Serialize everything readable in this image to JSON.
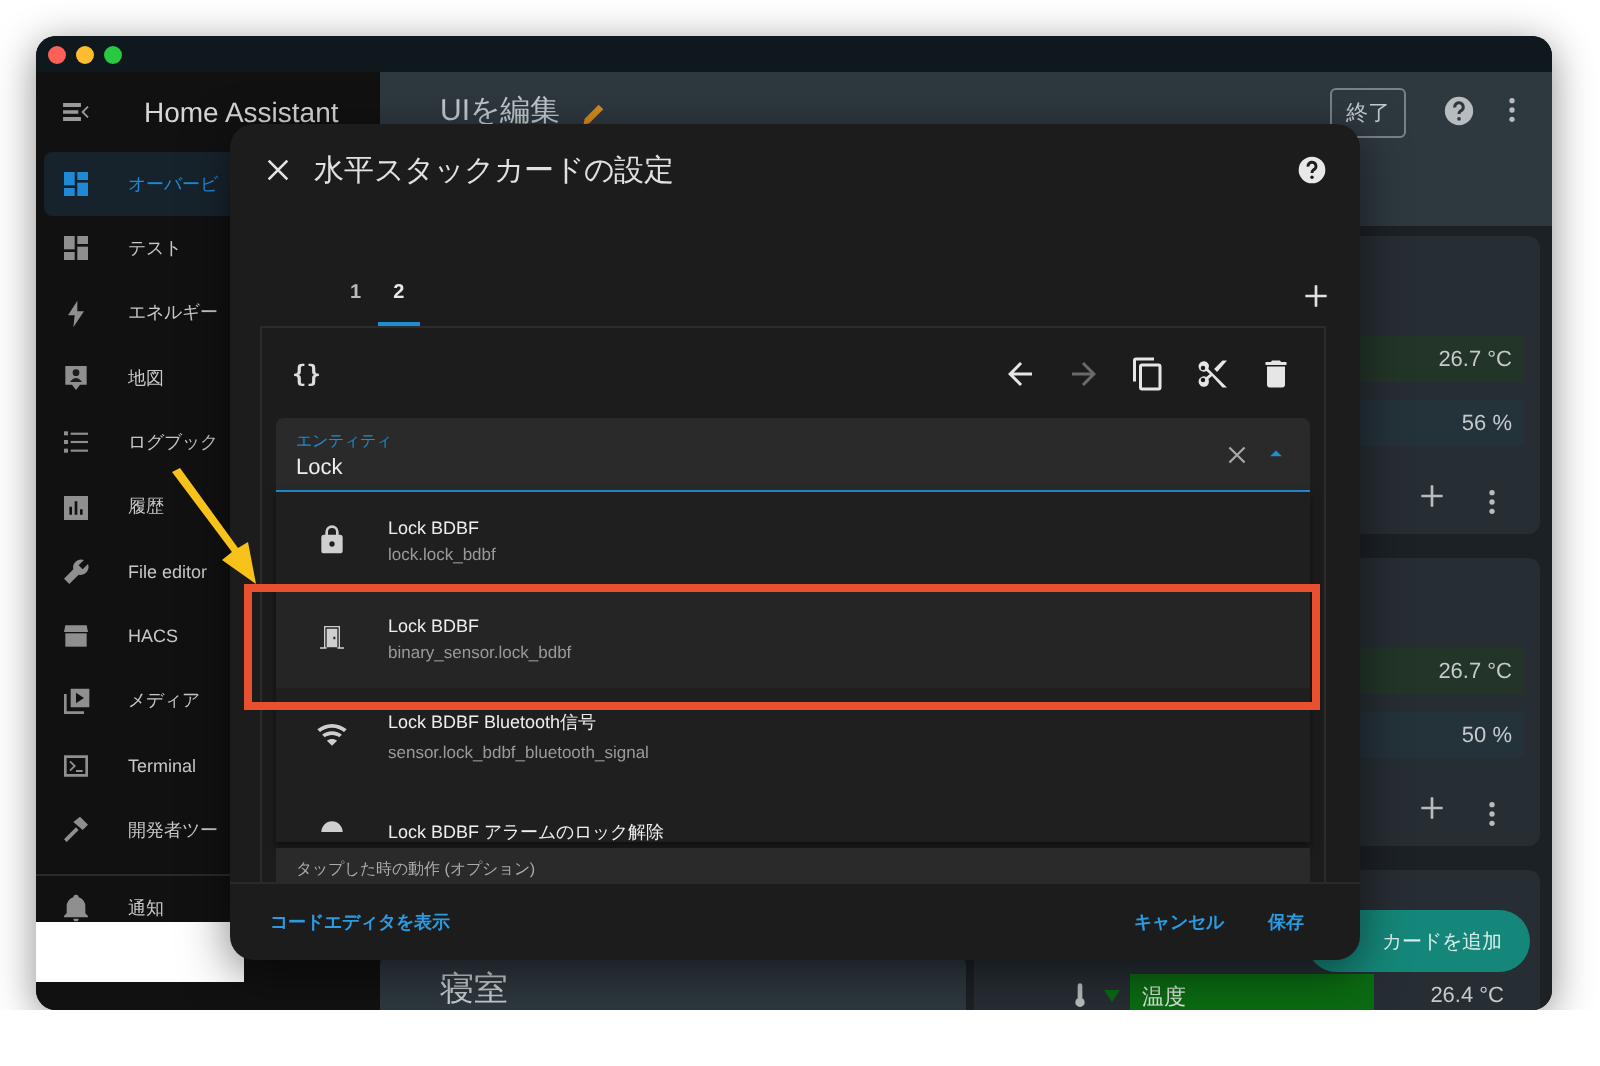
{
  "sidebar": {
    "title": "Home Assistant",
    "items": [
      {
        "label": "オーバービ",
        "kind": "dashboard",
        "selected": true
      },
      {
        "label": "テスト",
        "kind": "dashboard",
        "selected": false
      },
      {
        "label": "エネルギー",
        "kind": "bolt",
        "selected": false
      },
      {
        "label": "地図",
        "kind": "map",
        "selected": false
      },
      {
        "label": "ログブック",
        "kind": "list",
        "selected": false
      },
      {
        "label": "履歴",
        "kind": "chart",
        "selected": false
      },
      {
        "label": "File editor",
        "kind": "wrench",
        "selected": false
      },
      {
        "label": "HACS",
        "kind": "store",
        "selected": false
      },
      {
        "label": "メディア",
        "kind": "media",
        "selected": false
      },
      {
        "label": "Terminal",
        "kind": "terminal",
        "selected": false
      },
      {
        "label": "開発者ツー",
        "kind": "hammer",
        "selected": false
      }
    ],
    "footer_items": [
      {
        "label": "通知",
        "kind": "bell"
      }
    ]
  },
  "header": {
    "title": "UIを編集",
    "done_button": "終了"
  },
  "dashboard": {
    "right_cards": [
      {
        "rows": [
          {
            "value": "26.7 °C",
            "kind": "temperature"
          },
          {
            "value": "56 %",
            "kind": "humidity"
          }
        ]
      },
      {
        "rows": [
          {
            "value": "26.7 °C",
            "kind": "temperature"
          },
          {
            "value": "50 %",
            "kind": "humidity"
          }
        ]
      }
    ],
    "room_card": {
      "title": "寝室"
    },
    "temperature_row": {
      "label": "温度",
      "value": "26.4 °C"
    },
    "add_card_button": "カードを追加"
  },
  "dialog": {
    "title": "水平スタックカードの設定",
    "tabs": [
      {
        "label": "1",
        "selected": false
      },
      {
        "label": "2",
        "selected": true
      }
    ],
    "code_symbol": "{}",
    "toolbar_buttons": [
      {
        "kind": "undo",
        "disabled": false
      },
      {
        "kind": "redo",
        "disabled": true
      },
      {
        "kind": "copy",
        "disabled": false
      },
      {
        "kind": "cut",
        "disabled": false
      },
      {
        "kind": "delete",
        "disabled": false
      }
    ],
    "entity_field": {
      "label": "エンティティ",
      "value": "Lock"
    },
    "suggestions": [
      {
        "name": "Lock BDBF",
        "entity_id": "lock.lock_bdbf",
        "kind": "lock",
        "highlighted": false
      },
      {
        "name": "Lock BDBF",
        "entity_id": "binary_sensor.lock_bdbf",
        "kind": "door",
        "highlighted": true
      },
      {
        "name": "Lock BDBF Bluetooth信号",
        "entity_id": "sensor.lock_bdbf_bluetooth_signal",
        "kind": "wifi",
        "highlighted": false
      },
      {
        "name": "Lock BDBF アラームのロック解除",
        "kind": "alarm",
        "highlighted": false
      }
    ],
    "tap_action_label": "タップした時の動作 (オプション)",
    "footer": {
      "code_editor_link": "コードエディタを表示",
      "cancel": "キャンセル",
      "save": "保存"
    }
  }
}
